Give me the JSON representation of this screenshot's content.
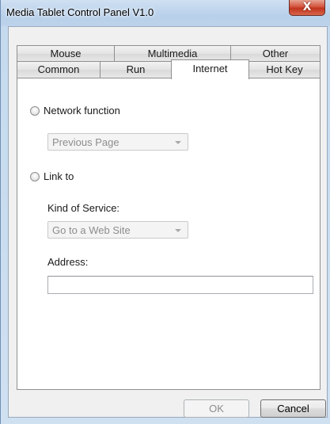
{
  "window": {
    "title": "Media Tablet Control Panel V1.0",
    "close_glyph": "X",
    "accent": "#c0341c"
  },
  "tabs": {
    "row_back": [
      {
        "label": "Mouse"
      },
      {
        "label": "Multimedia"
      },
      {
        "label": "Other"
      }
    ],
    "row_front": [
      {
        "label": "Common"
      },
      {
        "label": "Run"
      },
      {
        "label": "Internet",
        "active": true
      },
      {
        "label": "Hot Key"
      }
    ]
  },
  "panel": {
    "network_function": {
      "label": "Network function",
      "selected": false,
      "dropdown_value": "Previous Page"
    },
    "link_to": {
      "label": "Link to",
      "selected": false,
      "kind_of_service_label": "Kind of Service:",
      "kind_of_service_value": "Go to a Web Site",
      "address_label": "Address:",
      "address_value": ""
    }
  },
  "buttons": {
    "ok_label": "OK",
    "ok_enabled": false,
    "cancel_label": "Cancel"
  }
}
